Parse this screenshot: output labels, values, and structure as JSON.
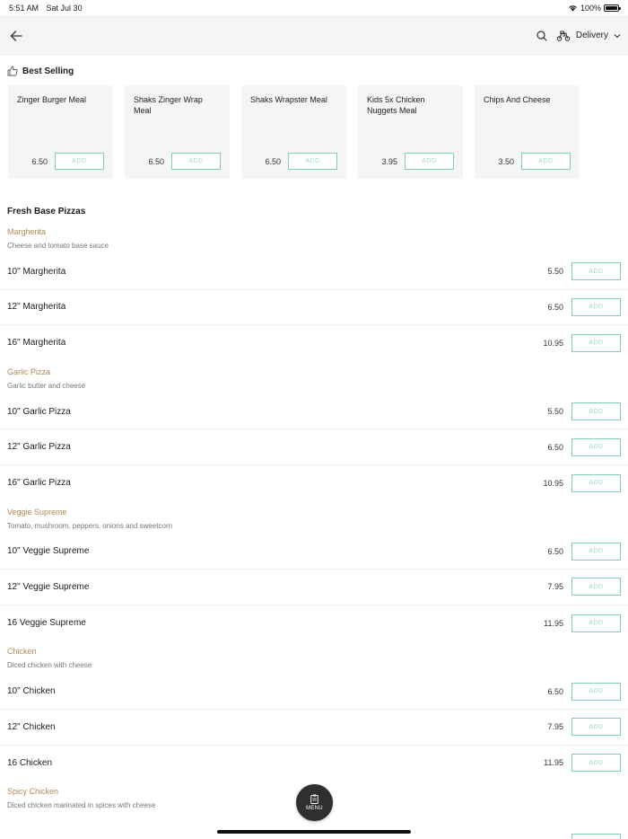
{
  "status": {
    "time": "5:51 AM",
    "date": "Sat Jul 30",
    "battery": "100%"
  },
  "header": {
    "mode_label": "Delivery"
  },
  "best_selling": {
    "title": "Best Selling",
    "items": [
      {
        "name": "Zinger Burger Meal",
        "price": "6.50",
        "add": "ADD"
      },
      {
        "name": "Shaks Zinger Wrap Meal",
        "price": "6.50",
        "add": "ADD"
      },
      {
        "name": "Shaks Wrapster Meal",
        "price": "6.50",
        "add": "ADD"
      },
      {
        "name": "Kids 5x Chicken Nuggets Meal",
        "price": "3.95",
        "add": "ADD"
      },
      {
        "name": "Chips And Cheese",
        "price": "3.50",
        "add": "ADD"
      }
    ]
  },
  "category": {
    "title": "Fresh Base Pizzas",
    "groups": [
      {
        "name": "Margherita",
        "desc": "Cheese and tomato base sauce",
        "items": [
          {
            "name": "10\" Margherita",
            "price": "5.50",
            "add": "ADD"
          },
          {
            "name": "12\" Margherita",
            "price": "6.50",
            "add": "ADD"
          },
          {
            "name": "16\" Margherita",
            "price": "10.95",
            "add": "ADD"
          }
        ]
      },
      {
        "name": "Garlic Pizza",
        "desc": "Garlic butter and cheese",
        "items": [
          {
            "name": "10\" Garlic Pizza",
            "price": "5.50",
            "add": "ADD"
          },
          {
            "name": "12\" Garlic Pizza",
            "price": "6.50",
            "add": "ADD"
          },
          {
            "name": "16\" Garlic Pizza",
            "price": "10.95",
            "add": "ADD"
          }
        ]
      },
      {
        "name": "Veggie Supreme",
        "desc": "Tomato, mushroom, peppers, onions and sweetcorn",
        "items": [
          {
            "name": "10\" Veggie Supreme",
            "price": "6.50",
            "add": "ADD"
          },
          {
            "name": "12\" Veggie Supreme",
            "price": "7.95",
            "add": "ADD"
          },
          {
            "name": "16 Veggie Supreme",
            "price": "11.95",
            "add": "ADD"
          }
        ]
      },
      {
        "name": "Chicken",
        "desc": "Diced chicken with cheese",
        "items": [
          {
            "name": "10\" Chicken",
            "price": "6.50",
            "add": "ADD"
          },
          {
            "name": "12\" Chicken",
            "price": "7.95",
            "add": "ADD"
          },
          {
            "name": "16 Chicken",
            "price": "11.95",
            "add": "ADD"
          }
        ]
      },
      {
        "name": "Spicy Chicken",
        "desc": "Diced chicken marinated in spices with cheese",
        "items": []
      }
    ]
  },
  "fab": {
    "label": "MENU"
  },
  "colors": {
    "accent_green": "#7fd0b1",
    "group_title": "#b08a57",
    "card_bg": "#f5f5f5"
  }
}
